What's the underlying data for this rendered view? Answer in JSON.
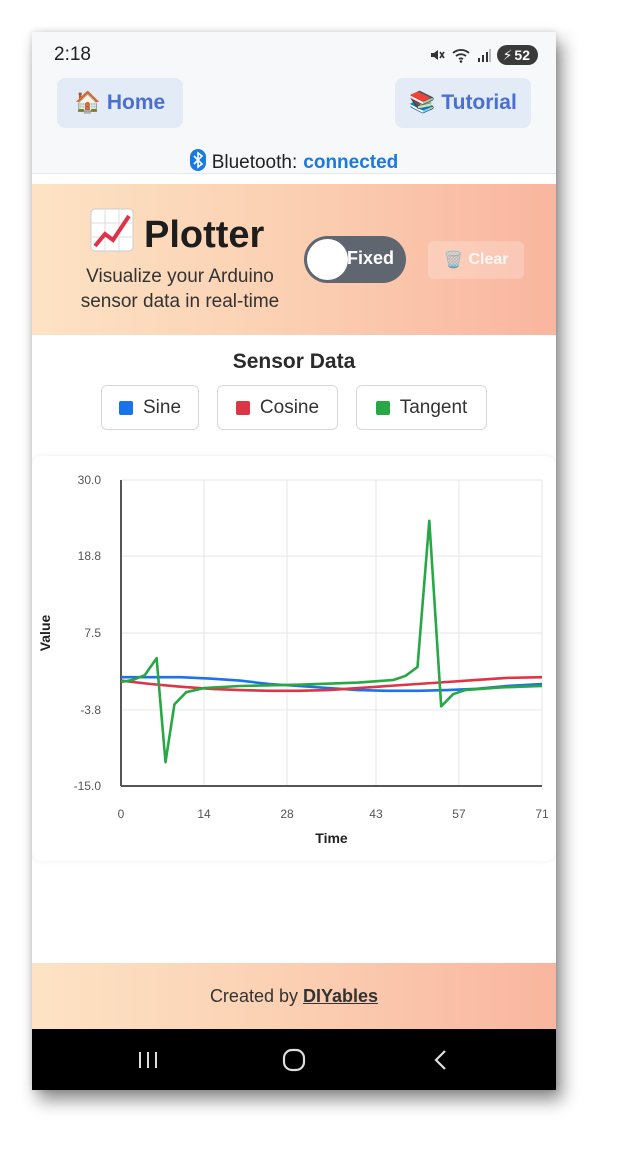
{
  "status_bar": {
    "time": "2:18",
    "battery": "52",
    "icons": [
      "mute-icon",
      "wifi-icon",
      "signal-icon",
      "battery-icon"
    ]
  },
  "nav": {
    "home_label": "Home",
    "home_icon": "house-icon",
    "tutorial_label": "Tutorial",
    "tutorial_icon": "books-icon"
  },
  "bluetooth": {
    "label": "Bluetooth:",
    "status": "connected",
    "status_color": "#1a7ae0"
  },
  "hero": {
    "title": "Plotter",
    "title_icon": "chart-increasing-icon",
    "subtitle": "Visualize your Arduino sensor data in real-time",
    "toggle_label": "Fixed",
    "clear_label": "Clear",
    "clear_icon": "trash-icon"
  },
  "sensor": {
    "title": "Sensor Data",
    "legend": [
      {
        "label": "Sine",
        "color": "#1a73e8"
      },
      {
        "label": "Cosine",
        "color": "#dc3545"
      },
      {
        "label": "Tangent",
        "color": "#28a745"
      }
    ]
  },
  "chart_data": {
    "type": "line",
    "xlabel": "Time",
    "ylabel": "Value",
    "xlim": [
      0,
      71
    ],
    "ylim": [
      -15.0,
      30.0
    ],
    "x_ticks": [
      "0",
      "14",
      "28",
      "43",
      "57",
      "71"
    ],
    "y_ticks": [
      "30.0",
      "18.8",
      "7.5",
      "-3.8",
      "-15.0"
    ],
    "grid": true,
    "series": [
      {
        "name": "Sine",
        "color": "#1a73e8",
        "points": [
          [
            0,
            1.0
          ],
          [
            5,
            1.0
          ],
          [
            10,
            1.0
          ],
          [
            15,
            0.8
          ],
          [
            20,
            0.5
          ],
          [
            25,
            0.0
          ],
          [
            30,
            -0.3
          ],
          [
            35,
            -0.6
          ],
          [
            40,
            -0.9
          ],
          [
            45,
            -1.0
          ],
          [
            50,
            -1.0
          ],
          [
            55,
            -0.9
          ],
          [
            60,
            -0.7
          ],
          [
            65,
            -0.3
          ],
          [
            71,
            0.0
          ]
        ]
      },
      {
        "name": "Cosine",
        "color": "#dc3545",
        "points": [
          [
            0,
            0.5
          ],
          [
            5,
            0.0
          ],
          [
            10,
            -0.4
          ],
          [
            15,
            -0.7
          ],
          [
            20,
            -0.9
          ],
          [
            25,
            -1.0
          ],
          [
            30,
            -1.0
          ],
          [
            35,
            -0.9
          ],
          [
            40,
            -0.6
          ],
          [
            45,
            -0.3
          ],
          [
            50,
            0.0
          ],
          [
            55,
            0.3
          ],
          [
            60,
            0.6
          ],
          [
            65,
            0.9
          ],
          [
            71,
            1.0
          ]
        ]
      },
      {
        "name": "Tangent",
        "color": "#28a745",
        "points": [
          [
            0,
            0.3
          ],
          [
            2,
            0.6
          ],
          [
            4,
            1.3
          ],
          [
            6,
            3.8
          ],
          [
            7.5,
            -11.5
          ],
          [
            9,
            -3.0
          ],
          [
            11,
            -1.2
          ],
          [
            14,
            -0.6
          ],
          [
            20,
            -0.3
          ],
          [
            30,
            -0.1
          ],
          [
            40,
            0.2
          ],
          [
            46,
            0.6
          ],
          [
            48,
            1.2
          ],
          [
            50,
            2.5
          ],
          [
            52,
            24.0
          ],
          [
            54,
            -3.3
          ],
          [
            56,
            -1.5
          ],
          [
            58,
            -0.9
          ],
          [
            64,
            -0.5
          ],
          [
            71,
            -0.3
          ]
        ]
      }
    ]
  },
  "footer": {
    "prefix": "Created by",
    "link": "DIYables"
  },
  "system_nav": {
    "buttons": [
      "recents-icon",
      "home-circle-icon",
      "back-icon"
    ]
  }
}
